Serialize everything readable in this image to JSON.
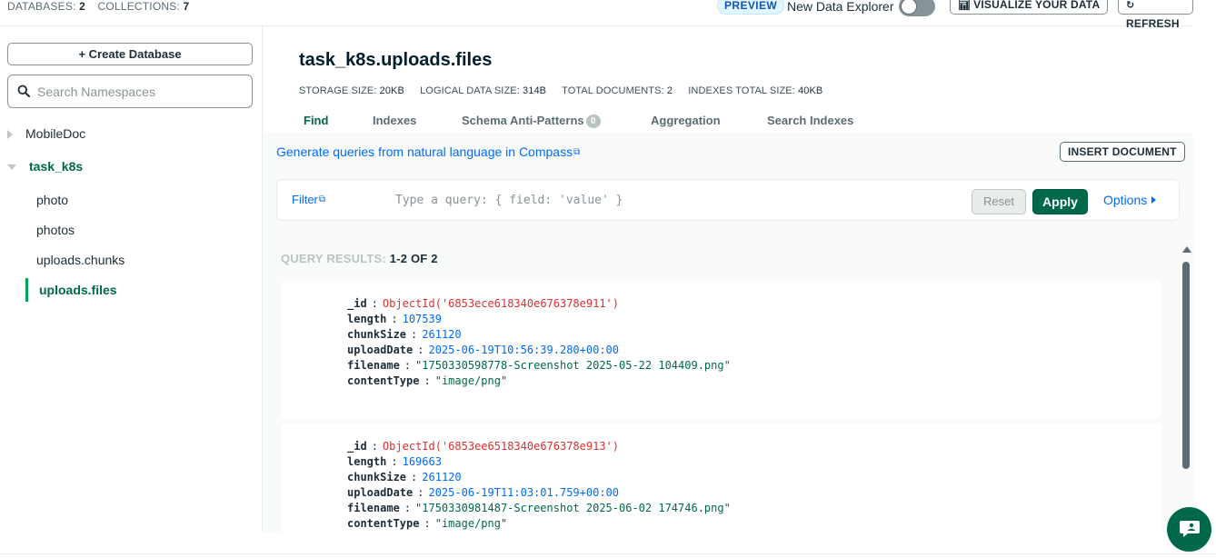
{
  "topbar": {
    "databases_label": "DATABASES:",
    "databases_count": "2",
    "collections_label": "COLLECTIONS:",
    "collections_count": "7",
    "preview_badge": "PREVIEW",
    "new_data_explorer": "New Data Explorer",
    "visualize_button": "VISUALIZE YOUR DATA",
    "refresh_button": "REFRESH"
  },
  "sidebar": {
    "create_database": "+ Create Database",
    "search_placeholder": "Search Namespaces",
    "databases": [
      {
        "name": "MobileDoc",
        "expanded": false
      },
      {
        "name": "task_k8s",
        "expanded": true
      }
    ],
    "collections": [
      "photo",
      "photos",
      "uploads.chunks",
      "uploads.files"
    ],
    "active_collection": "uploads.files"
  },
  "collection": {
    "title": "task_k8s.uploads.files",
    "stats": {
      "storage_label": "STORAGE SIZE:",
      "storage_value": "20KB",
      "logical_label": "LOGICAL DATA SIZE:",
      "logical_value": "314B",
      "docs_label": "TOTAL DOCUMENTS:",
      "docs_value": "2",
      "indexes_label": "INDEXES TOTAL SIZE:",
      "indexes_value": "40KB"
    },
    "tabs": [
      {
        "label": "Find",
        "active": true
      },
      {
        "label": "Indexes"
      },
      {
        "label": "Schema Anti-Patterns",
        "badge": "0"
      },
      {
        "label": "Aggregation"
      },
      {
        "label": "Search Indexes"
      }
    ]
  },
  "query": {
    "nl_link": "Generate queries from natural language in Compass",
    "insert_document": "INSERT DOCUMENT",
    "filter_label": "Filter",
    "filter_placeholder": "Type a query: { field: 'value' }",
    "reset": "Reset",
    "apply": "Apply",
    "options": "Options"
  },
  "results": {
    "label": "QUERY RESULTS:",
    "range": "1-2 OF 2",
    "documents": [
      {
        "_id": "ObjectId('6853ece618340e676378e911')",
        "length": "107539",
        "chunkSize": "261120",
        "uploadDate": "2025-06-19T10:56:39.280+00:00",
        "filename": "\"1750330598778-Screenshot 2025-05-22 104409.png\"",
        "contentType": "\"image/png\""
      },
      {
        "_id": "ObjectId('6853ee6518340e676378e913')",
        "length": "169663",
        "chunkSize": "261120",
        "uploadDate": "2025-06-19T11:03:01.759+00:00",
        "filename": "\"1750330981487-Screenshot 2025-06-02 174746.png\"",
        "contentType": "\"image/png\""
      }
    ],
    "field_names": {
      "id": "_id",
      "length": "length",
      "chunkSize": "chunkSize",
      "uploadDate": "uploadDate",
      "filename": "filename",
      "contentType": "contentType"
    }
  },
  "colors": {
    "brand_green": "#00684a",
    "link_blue": "#016bf8",
    "oid_red": "#db3030"
  },
  "icons": {
    "search": "search-icon",
    "chart": "bar-chart-icon",
    "refresh": "refresh-icon",
    "external": "external-link-icon",
    "chat": "chat-icon"
  }
}
